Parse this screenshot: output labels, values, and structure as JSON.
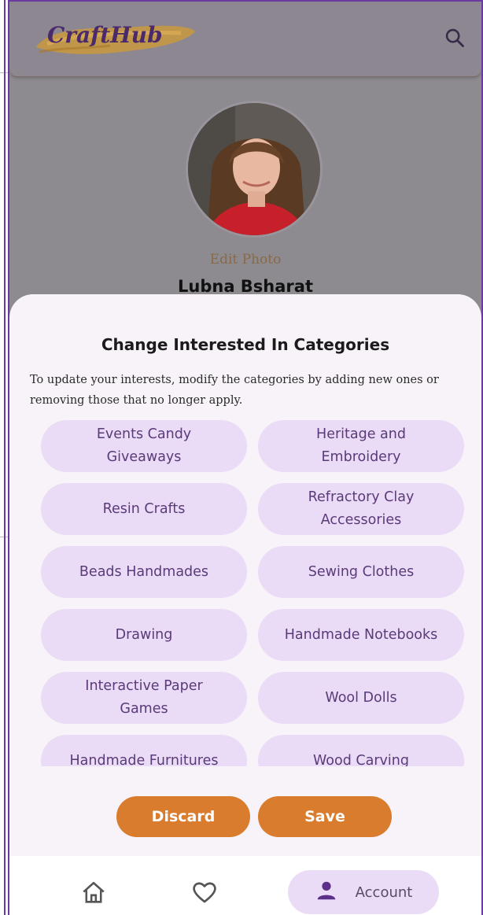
{
  "app": {
    "logo_text": "CraftHub"
  },
  "profile": {
    "edit_photo_label": "Edit Photo",
    "name": "Lubna Bsharat"
  },
  "sheet": {
    "title": "Change Interested In Categories",
    "description": "To update your interests, modify the categories by adding new ones or removing those that no longer apply.",
    "categories": [
      "Events Candy Giveaways",
      "Heritage and Embroidery",
      "Resin Crafts",
      "Refractory Clay Accessories",
      "Beads Handmades",
      "Sewing Clothes",
      "Drawing",
      "Handmade Notebooks",
      "Interactive Paper Games",
      "Wool Dolls",
      "Handmade Furnitures",
      "Wood Carving"
    ],
    "discard_label": "Discard",
    "save_label": "Save"
  },
  "navbar": {
    "account_label": "Account"
  },
  "colors": {
    "accent_orange": "#d97c2e",
    "chip_bg": "#eadcf7",
    "chip_text": "#5a3a78",
    "frame_border": "#6a3aa0"
  },
  "icons": {
    "search": "search-icon",
    "home": "home-icon",
    "favorite": "heart-icon",
    "account": "person-icon"
  }
}
